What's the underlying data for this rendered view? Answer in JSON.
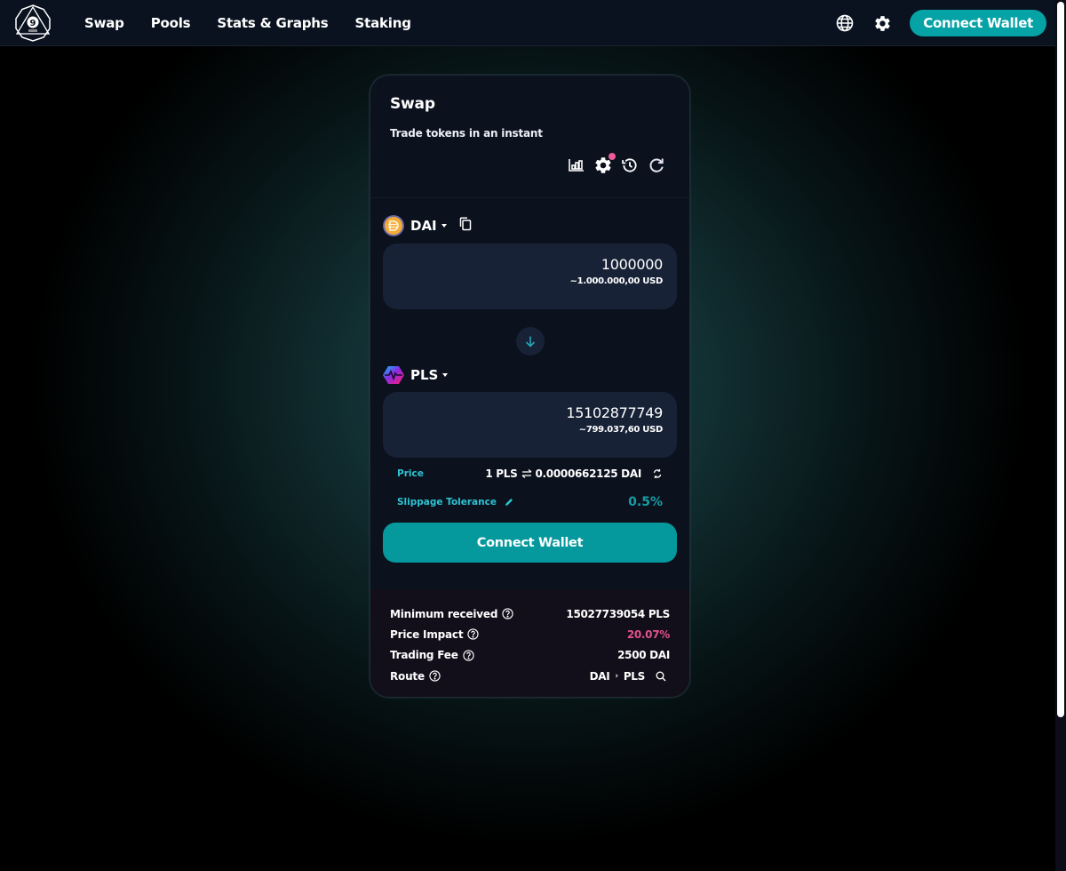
{
  "nav": {
    "logo_alt": "9inch",
    "links": [
      {
        "label": "Swap"
      },
      {
        "label": "Pools"
      },
      {
        "label": "Stats & Graphs"
      },
      {
        "label": "Staking"
      }
    ],
    "icons": [
      "globe-icon",
      "gear-icon"
    ],
    "connect_label": "Connect Wallet"
  },
  "swap": {
    "title": "Swap",
    "subtitle": "Trade tokens in an instant",
    "header_icons": [
      "chart-icon",
      "settings-icon",
      "history-icon",
      "refresh-icon"
    ],
    "settings_badge": true,
    "from": {
      "symbol": "DAI",
      "amount": "1000000",
      "usd": "~1.000.000,00 USD",
      "logo_color": "#f5ac37"
    },
    "to": {
      "symbol": "PLS",
      "amount": "15102877749",
      "usd": "~799.037,60 USD"
    },
    "price": {
      "label": "Price",
      "base": "1 PLS",
      "quote": "0.0000662125 DAI"
    },
    "slippage": {
      "label": "Slippage Tolerance",
      "value": "0.5%"
    },
    "connect_label": "Connect Wallet",
    "details": {
      "minimum_received": {
        "label": "Minimum received",
        "value": "15027739054 PLS"
      },
      "price_impact": {
        "label": "Price Impact",
        "value": "20.07%"
      },
      "trading_fee": {
        "label": "Trading Fee",
        "value": "2500 DAI"
      },
      "route": {
        "label": "Route",
        "from": "DAI",
        "sep": "›",
        "to": "PLS"
      }
    }
  },
  "colors": {
    "accent": "#05a2a6",
    "price_label": "#2cc4d4",
    "impact_warning": "#e0518c",
    "badge": "#ee5b9b"
  }
}
